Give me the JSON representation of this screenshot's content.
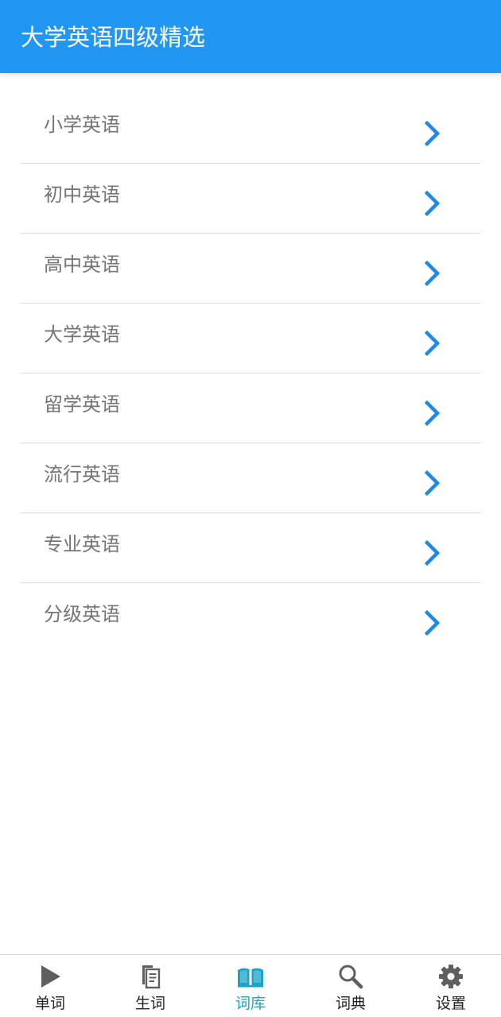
{
  "header": {
    "title": "大学英语四级精选"
  },
  "list": {
    "items": [
      {
        "label": "小学英语"
      },
      {
        "label": "初中英语"
      },
      {
        "label": "高中英语"
      },
      {
        "label": "大学英语"
      },
      {
        "label": "留学英语"
      },
      {
        "label": "流行英语"
      },
      {
        "label": "专业英语"
      },
      {
        "label": "分级英语"
      }
    ]
  },
  "bottom_nav": {
    "tabs": [
      {
        "label": "单词",
        "icon": "play-icon",
        "active": false
      },
      {
        "label": "生词",
        "icon": "document-icon",
        "active": false
      },
      {
        "label": "词库",
        "icon": "book-icon",
        "active": true
      },
      {
        "label": "词典",
        "icon": "search-icon",
        "active": false
      },
      {
        "label": "设置",
        "icon": "gear-icon",
        "active": false
      }
    ]
  },
  "colors": {
    "header_bg": "#2196f3",
    "chevron": "#1e88e5",
    "active_tab": "#1aa3c8",
    "inactive_icon": "#5f5f5f",
    "item_text": "#757575"
  }
}
